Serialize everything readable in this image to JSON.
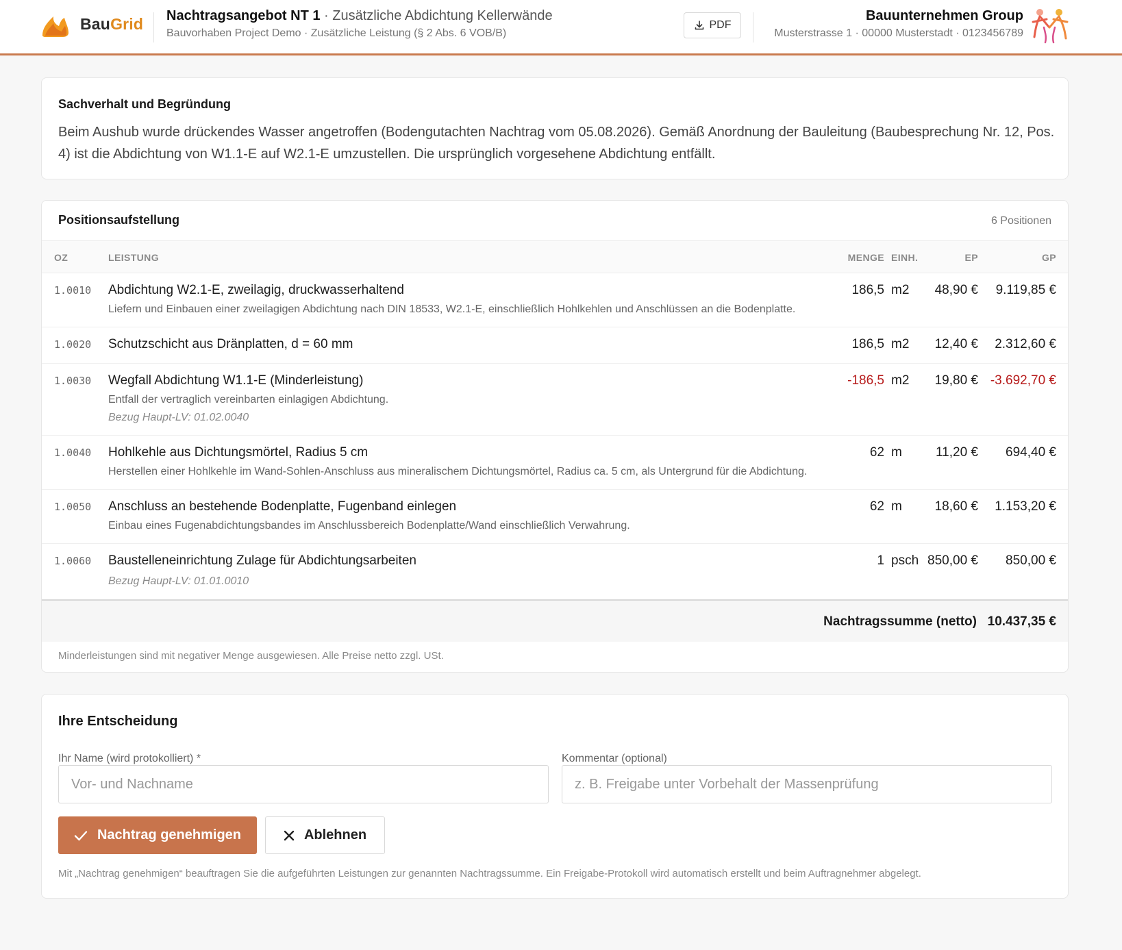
{
  "header": {
    "brand_a": "Bau",
    "brand_b": "Grid",
    "title_bold": "Nachtragsangebot NT 1",
    "title_rest": " · Zusätzliche Abdichtung Kellerwände",
    "subtitle": "Bauvorhaben Project Demo · Zusätzliche Leistung (§ 2 Abs. 6 VOB/B)",
    "pdf_label": "PDF",
    "company_name": "Bauunternehmen Group",
    "company_address": "Musterstrasse 1 · 00000 Musterstadt · 0123456789"
  },
  "sachverhalt": {
    "heading": "Sachverhalt und Begründung",
    "text": "Beim Aushub wurde drückendes Wasser angetroffen (Bodengutachten Nachtrag vom 05.08.2026). Gemäß Anordnung der Bauleitung (Baubesprechung Nr. 12, Pos. 4) ist die Abdichtung von W1.1-E auf W2.1-E umzustellen. Die ursprünglich vorgesehene Abdichtung entfällt."
  },
  "positions": {
    "heading": "Positionsaufstellung",
    "count": "6 Positionen",
    "columns": {
      "oz": "OZ",
      "leistung": "LEISTUNG",
      "menge": "MENGE",
      "einh": "EINH.",
      "ep": "EP",
      "gp": "GP"
    },
    "rows": [
      {
        "oz": "1.0010",
        "title": "Abdichtung W2.1-E, zweilagig, druckwasserhaltend",
        "desc": "Liefern und Einbauen einer zweilagigen Abdichtung nach DIN 18533, W2.1-E, einschließlich Hohlkehlen und Anschlüssen an die Bodenplatte.",
        "ref": "",
        "menge": "186,5",
        "einh": "m2",
        "ep": "48,90 €",
        "gp": "9.119,85 €"
      },
      {
        "oz": "1.0020",
        "title": "Schutzschicht aus Dränplatten, d = 60 mm",
        "desc": "",
        "ref": "",
        "menge": "186,5",
        "einh": "m2",
        "ep": "12,40 €",
        "gp": "2.312,60 €"
      },
      {
        "oz": "1.0030",
        "title": "Wegfall Abdichtung W1.1-E (Minderleistung)",
        "desc": "Entfall der vertraglich vereinbarten einlagigen Abdichtung.",
        "ref": "Bezug Haupt-LV: 01.02.0040",
        "menge": "-186,5",
        "einh": "m2",
        "ep": "19,80 €",
        "gp": "-3.692,70 €"
      },
      {
        "oz": "1.0040",
        "title": "Hohlkehle aus Dichtungsmörtel, Radius 5 cm",
        "desc": "Herstellen einer Hohlkehle im Wand-Sohlen-Anschluss aus mineralischem Dichtungsmörtel, Radius ca. 5 cm, als Untergrund für die Abdichtung.",
        "ref": "",
        "menge": "62",
        "einh": "m",
        "ep": "11,20 €",
        "gp": "694,40 €"
      },
      {
        "oz": "1.0050",
        "title": "Anschluss an bestehende Bodenplatte, Fugenband einlegen",
        "desc": "Einbau eines Fugenabdichtungsbandes im Anschlussbereich Bodenplatte/Wand einschließlich Verwahrung.",
        "ref": "",
        "menge": "62",
        "einh": "m",
        "ep": "18,60 €",
        "gp": "1.153,20 €"
      },
      {
        "oz": "1.0060",
        "title": "Baustelleneinrichtung Zulage für Abdichtungsarbeiten",
        "desc": "",
        "ref": "Bezug Haupt-LV: 01.01.0010",
        "menge": "1",
        "einh": "psch",
        "ep": "850,00 €",
        "gp": "850,00 €"
      }
    ],
    "sum_label": "Nachtragssumme (netto)",
    "sum_value": "10.437,35 €",
    "note": "Minderleistungen sind mit negativer Menge ausgewiesen. Alle Preise netto zzgl. USt."
  },
  "decision": {
    "heading": "Ihre Entscheidung",
    "name_label": "Ihr Name (wird protokolliert) *",
    "name_placeholder": "Vor- und Nachname",
    "name_value": "",
    "comment_label": "Kommentar (optional)",
    "comment_placeholder": "z. B. Freigabe unter Vorbehalt der Massenprüfung",
    "comment_value": "",
    "approve_label": "Nachtrag genehmigen",
    "reject_label": "Ablehnen",
    "legal": "Mit „Nachtrag genehmigen“ beauftragen Sie die aufgeführten Leistungen zur genannten Nachtragssumme. Ein Freigabe-Protokoll wird automatisch erstellt und beim Auftragnehmer abgelegt."
  },
  "colors": {
    "accent": "#c8744c",
    "header_border": "#c97a4e",
    "brand_orange": "#e08a1e",
    "negative": "#b71c1c"
  },
  "icons": [
    "flame-logo-icon",
    "download-icon",
    "company-logo-icon",
    "check-icon",
    "close-icon"
  ]
}
